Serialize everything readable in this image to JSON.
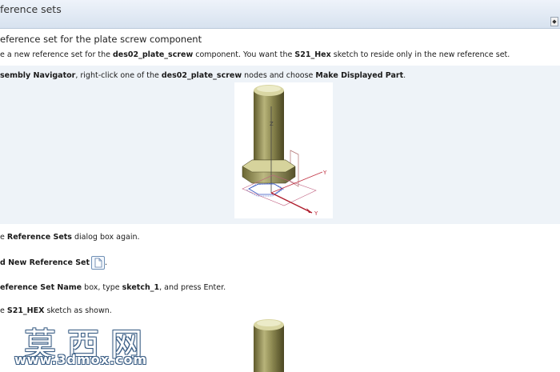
{
  "header": {
    "title": "ference sets",
    "side_button_glyph": "◆"
  },
  "topic": {
    "title": "eference set for the plate screw component",
    "intro": {
      "a": "e a new reference set for the ",
      "b": "des02_plate_screw",
      "c": " component. You want the ",
      "d": "S21_Hex",
      "e": " sketch to reside only in the new reference set."
    }
  },
  "steps": [
    {
      "a": "sembly Navigator",
      "b": ", right-click one of the ",
      "c": "des02_plate_screw",
      "d": " nodes and choose ",
      "e": "Make Displayed Part",
      "f": "."
    },
    {
      "a": "e ",
      "b": "Reference Sets",
      "c": " dialog box again."
    },
    {
      "a": "d New Reference Set",
      "b": "."
    },
    {
      "a": "eference Set Name",
      "b": " box, type ",
      "c": "sketch_1",
      "d": ", and press Enter."
    },
    {
      "a": "e ",
      "b": "S21_HEX",
      "c": " sketch as shown."
    }
  ],
  "figure": {
    "label_z": "Z",
    "label_y1": "Y",
    "label_y2": "Y"
  },
  "watermark": {
    "chars": "莫西网",
    "url": "www.3dmox.com"
  }
}
